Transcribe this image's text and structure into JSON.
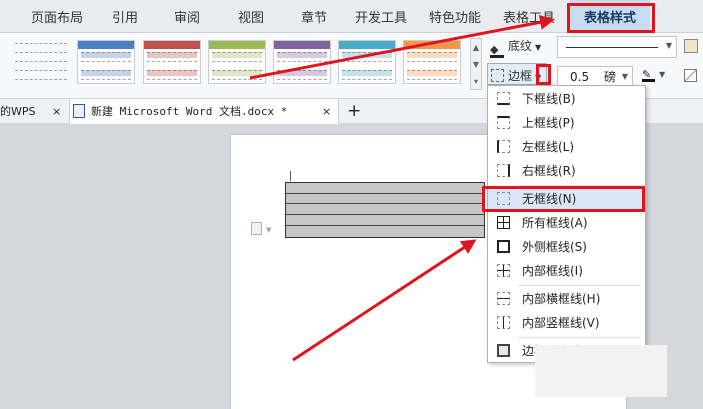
{
  "menu": {
    "tabs": [
      "页面布局",
      "引用",
      "审阅",
      "视图",
      "章节",
      "开发工具",
      "特色功能",
      "表格工具",
      "表格样式"
    ]
  },
  "ribbon": {
    "shading_label": "底纹",
    "border_label": "边框",
    "line_width_value": "0.5",
    "line_width_unit": "磅",
    "swatch_colors": [
      "#ffffff",
      "#4a7fc1",
      "#c0504d",
      "#9bbb59",
      "#8064a2",
      "#4bacc6",
      "#f79646"
    ]
  },
  "tabs": {
    "prev_label": "的WPS",
    "close_glyph": "×",
    "doc_label": "新建 Microsoft Word 文档.docx *",
    "add_glyph": "+"
  },
  "border_menu": {
    "items": [
      {
        "label": "下框线(B)"
      },
      {
        "label": "上框线(P)"
      },
      {
        "label": "左框线(L)"
      },
      {
        "label": "右框线(R)"
      },
      {
        "label": "无框线(N)"
      },
      {
        "label": "所有框线(A)"
      },
      {
        "label": "外侧框线(S)"
      },
      {
        "label": "内部框线(I)"
      },
      {
        "label": "内部横框线(H)"
      },
      {
        "label": "内部竖框线(V)"
      },
      {
        "label": "边框和底纹(O)..."
      }
    ]
  },
  "colors": {
    "accent_red": "#e0141e",
    "selected_tab": "#c8dcf0",
    "hover_item": "#dbe7f6"
  }
}
